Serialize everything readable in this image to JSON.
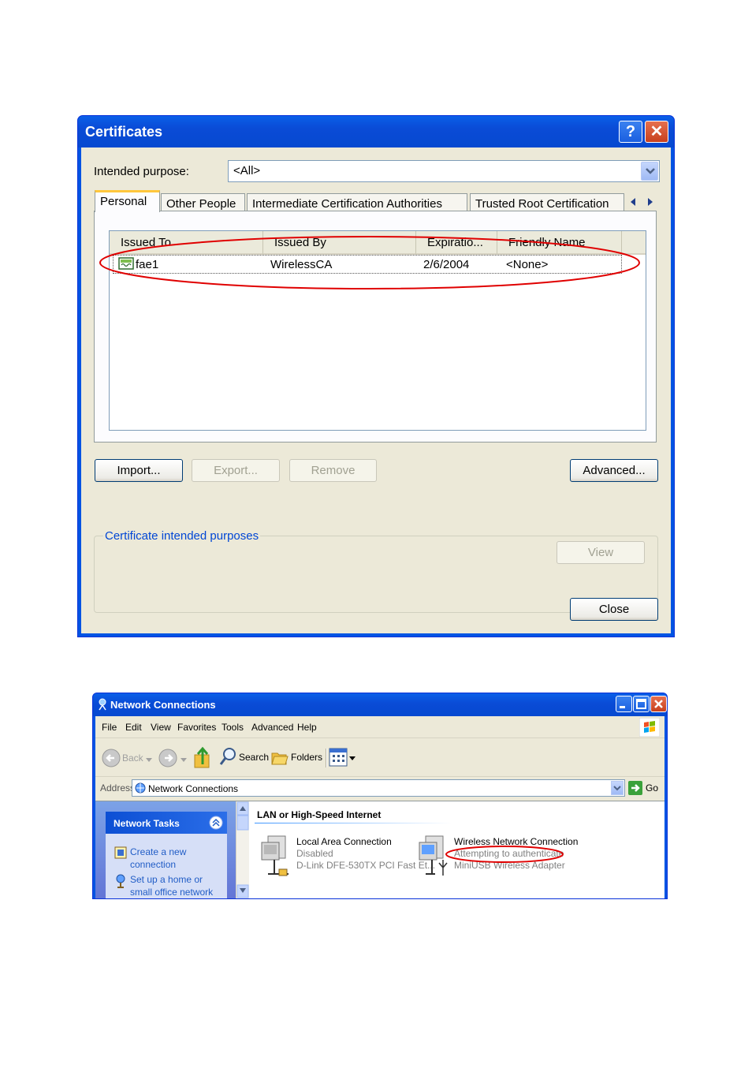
{
  "certificates_dialog": {
    "title": "Certificates",
    "help_glyph": "?",
    "close_glyph": "✕",
    "purpose_label": "Intended purpose:",
    "purpose_value": "<All>",
    "tabs": [
      {
        "label": "Personal",
        "selected": true
      },
      {
        "label": "Other People"
      },
      {
        "label": "Intermediate Certification Authorities"
      },
      {
        "label": "Trusted Root Certification"
      }
    ],
    "columns": [
      "Issued To",
      "Issued By",
      "Expiratio...",
      "Friendly Name"
    ],
    "rows": [
      {
        "issued_to": "fae1",
        "issued_by": "WirelessCA",
        "expiration": "2/6/2004",
        "friendly_name": "<None>",
        "icon": "certificate-icon"
      }
    ],
    "buttons": {
      "import": "Import...",
      "export": "Export...",
      "remove": "Remove",
      "advanced": "Advanced...",
      "view": "View",
      "close": "Close"
    },
    "purposes_group_label": "Certificate intended purposes"
  },
  "network_connections": {
    "title": "Network Connections",
    "menu": [
      "File",
      "Edit",
      "View",
      "Favorites",
      "Tools",
      "Advanced",
      "Help"
    ],
    "toolbar": {
      "back": "Back",
      "search": "Search",
      "folders": "Folders"
    },
    "address_label": "Address",
    "address_value": "Network Connections",
    "go_label": "Go",
    "tasks": {
      "header": "Network Tasks",
      "items": [
        {
          "label": "Create a new connection",
          "icon": "new-connection-icon"
        },
        {
          "label": "Set up a home or small office network",
          "icon": "home-network-icon"
        }
      ]
    },
    "group_heading": "LAN or High-Speed Internet",
    "connections": [
      {
        "name": "Local Area Connection",
        "status": "Disabled",
        "device": "D-Link DFE-530TX PCI Fast Et...",
        "icon": "lan-connection-icon"
      },
      {
        "name": "Wireless Network Connection",
        "status": "Attempting to authenticate",
        "device": "MiniUSB Wireless Adapter",
        "icon": "wireless-connection-icon"
      }
    ]
  },
  "colors": {
    "xp_title_blue": "#0054e3",
    "dialog_face": "#ece9d8",
    "link_blue": "#215dc6",
    "annotation_red": "#e00000"
  }
}
